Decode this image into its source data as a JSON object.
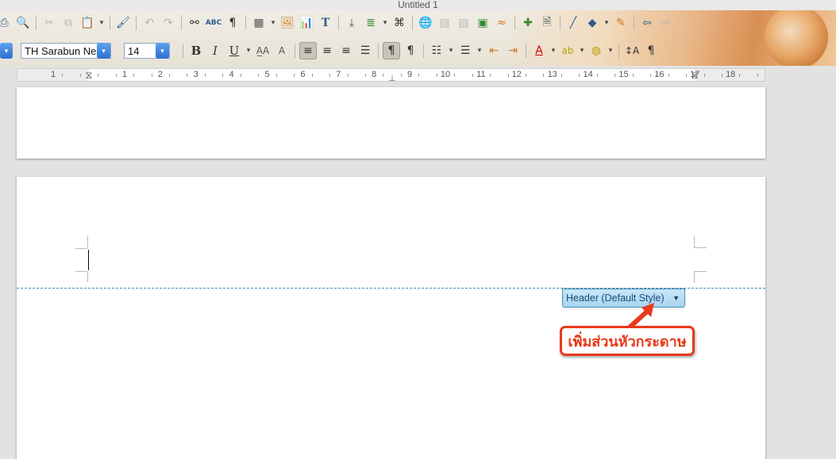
{
  "window": {
    "title": "Untitled 1"
  },
  "toolbar": {
    "font_name": "TH Sarabun Ne",
    "font_size": "14",
    "bold_label": "B",
    "italic_label": "I",
    "underline_label": "U"
  },
  "ruler": {
    "numbers": [
      "1",
      "1",
      "2",
      "3",
      "4",
      "5",
      "6",
      "7",
      "8",
      "9",
      "10",
      "11",
      "12",
      "13",
      "14",
      "15",
      "16",
      "17",
      "18"
    ]
  },
  "document": {
    "header_tag_label": "Header (Default Style)"
  },
  "annotation": {
    "callout_text": "เพิ่มส่วนหัวกระดาษ",
    "color": "#e83a1b"
  },
  "icons": {
    "standard_toolbar": [
      "print-icon",
      "print-preview-icon",
      "cut-icon",
      "copy-icon",
      "paste-icon",
      "clone-formatting-icon",
      "undo-icon",
      "redo-icon",
      "find-replace-icon",
      "spelling-icon",
      "formatting-marks-icon",
      "table-icon",
      "image-icon",
      "chart-icon",
      "text-box-icon",
      "page-break-icon",
      "field-icon",
      "special-character-icon",
      "hyperlink-icon",
      "footnote-icon",
      "endnote-icon",
      "bookmark-icon",
      "cross-reference-icon",
      "comment-icon",
      "track-changes-icon",
      "line-icon",
      "basic-shapes-icon",
      "draw-functions-icon",
      "navigate-back-icon",
      "navigate-forward-icon"
    ],
    "formatting_toolbar": [
      "paragraph-style-icon",
      "bold-icon",
      "italic-icon",
      "underline-icon",
      "shadow-icon",
      "outline-icon",
      "align-left-icon",
      "align-center-icon",
      "align-right-icon",
      "justify-icon",
      "ltr-icon",
      "rtl-icon",
      "ordered-list-icon",
      "unordered-list-icon",
      "decrease-indent-icon",
      "increase-indent-icon",
      "font-color-icon",
      "highlight-icon",
      "background-color-icon",
      "character-icon",
      "paragraph-icon"
    ]
  }
}
